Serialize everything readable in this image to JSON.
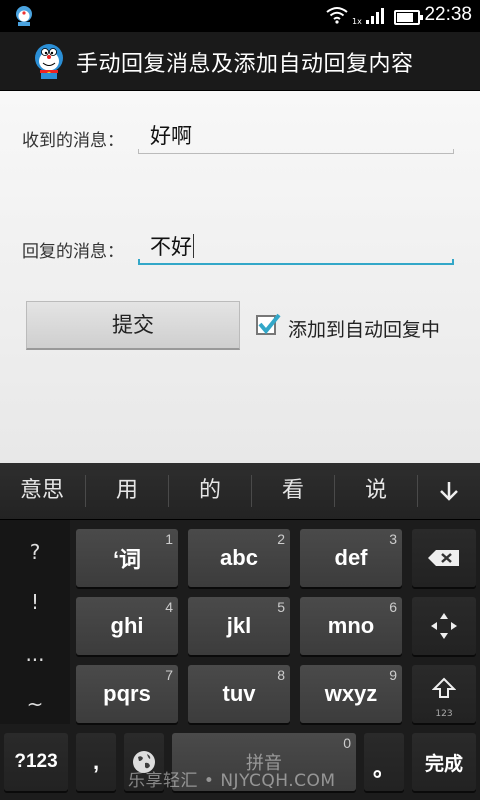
{
  "status": {
    "time": "22:38",
    "network_label": "1x",
    "battery_percent": 90
  },
  "actionbar": {
    "title": "手动回复消息及添加自动回复内容"
  },
  "form": {
    "received_label": "收到的消息：",
    "received_value": "好啊",
    "reply_label": "回复的消息：",
    "reply_value": "不好",
    "submit_label": "提交",
    "auto_reply_label": "添加到自动回复中",
    "auto_reply_checked": true
  },
  "keyboard": {
    "candidates": [
      "意思",
      "用",
      "的",
      "看",
      "说"
    ],
    "symbols": [
      "?",
      "!",
      "...",
      "~"
    ],
    "keys": [
      {
        "label": "‘词",
        "num": "1"
      },
      {
        "label": "abc",
        "num": "2"
      },
      {
        "label": "def",
        "num": "3"
      },
      {
        "label": "ghi",
        "num": "4"
      },
      {
        "label": "jkl",
        "num": "5"
      },
      {
        "label": "mno",
        "num": "6"
      },
      {
        "label": "pqrs",
        "num": "7"
      },
      {
        "label": "tuv",
        "num": "8"
      },
      {
        "label": "wxyz",
        "num": "9"
      }
    ],
    "shift_sub": "123",
    "sym_key": "?123",
    "comma_key": ",",
    "space_label": "拼音",
    "space_num": "0",
    "period_key": "。",
    "done_key": "完成"
  },
  "watermark": "乐享轻汇 • NJYCQH.COM",
  "colors": {
    "accent": "#33a7c8",
    "actionbar": "#1a1a1a",
    "keyboard": "#1c1c1c"
  }
}
